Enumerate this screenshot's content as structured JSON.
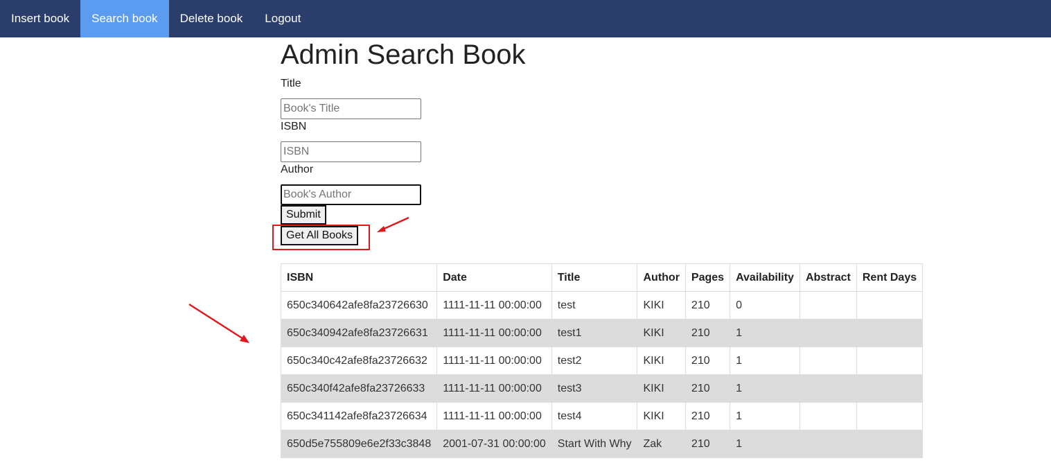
{
  "nav": {
    "items": [
      {
        "label": "Insert book",
        "active": false
      },
      {
        "label": "Search book",
        "active": true
      },
      {
        "label": "Delete book",
        "active": false
      },
      {
        "label": "Logout",
        "active": false
      }
    ]
  },
  "page": {
    "title": "Admin Search Book"
  },
  "form": {
    "title_label": "Title",
    "title_placeholder": "Book's Title",
    "title_value": "",
    "isbn_label": "ISBN",
    "isbn_placeholder": "ISBN",
    "isbn_value": "",
    "author_label": "Author",
    "author_placeholder": "Book's Author",
    "author_value": "",
    "submit_label": "Submit",
    "get_all_label": "Get All Books"
  },
  "table": {
    "headers": [
      "ISBN",
      "Date",
      "Title",
      "Author",
      "Pages",
      "Availability",
      "Abstract",
      "Rent Days"
    ],
    "rows": [
      [
        "650c340642afe8fa23726630",
        "1111-11-11 00:00:00",
        "test",
        "KIKI",
        "210",
        "0",
        "",
        ""
      ],
      [
        "650c340942afe8fa23726631",
        "1111-11-11 00:00:00",
        "test1",
        "KIKI",
        "210",
        "1",
        "",
        ""
      ],
      [
        "650c340c42afe8fa23726632",
        "1111-11-11 00:00:00",
        "test2",
        "KIKI",
        "210",
        "1",
        "",
        ""
      ],
      [
        "650c340f42afe8fa23726633",
        "1111-11-11 00:00:00",
        "test3",
        "KIKI",
        "210",
        "1",
        "",
        ""
      ],
      [
        "650c341142afe8fa23726634",
        "1111-11-11 00:00:00",
        "test4",
        "KIKI",
        "210",
        "1",
        "",
        ""
      ],
      [
        "650d5e755809e6e2f33c3848",
        "2001-07-31 00:00:00",
        "Start With Why",
        "Zak",
        "210",
        "1",
        "",
        ""
      ]
    ]
  },
  "colors": {
    "navbar": "#2b3d6b",
    "nav_active": "#5b9cf0",
    "annotation": "#e3171b",
    "striped_row": "#dcdcdc"
  }
}
